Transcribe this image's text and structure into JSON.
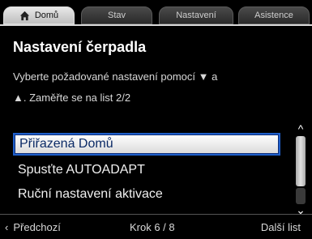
{
  "tabs": [
    {
      "label": "Domů",
      "icon": "home-icon",
      "active": true
    },
    {
      "label": "Stav",
      "active": false
    },
    {
      "label": "Nastavení",
      "active": false
    },
    {
      "label": "Asistence",
      "active": false
    }
  ],
  "page": {
    "title": "Nastavení čerpadla",
    "description_line1": "Vyberte požadované nastavení pomocí ▼ a",
    "description_line2": "▲. Zaměřte se na list 2/2"
  },
  "list": {
    "items": [
      {
        "label": "Přiřazená Domů",
        "selected": true
      },
      {
        "label": "Spusťte AUTOADAPT",
        "selected": false
      },
      {
        "label": "Ruční nastavení aktivace",
        "selected": false
      }
    ]
  },
  "footer": {
    "back_label": "Předchozí",
    "step_label": "Krok 6 / 8",
    "next_label": "Další list"
  },
  "colors": {
    "selection_border": "#1f5fc9",
    "selection_text": "#0b2a66"
  }
}
